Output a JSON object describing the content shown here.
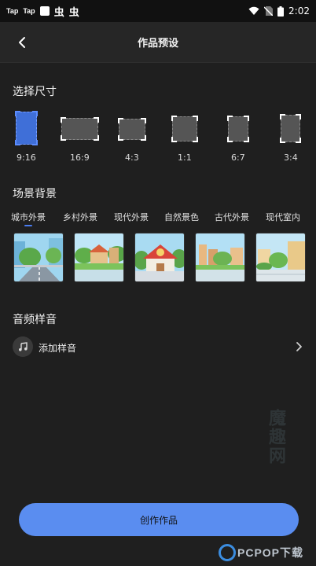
{
  "status_bar": {
    "apps": [
      "Tap",
      "Tap"
    ],
    "bug_glyphs": [
      "虫",
      "虫"
    ],
    "time": "2:02"
  },
  "header": {
    "title": "作品预设"
  },
  "size_section": {
    "title": "选择尺寸",
    "options": [
      {
        "label": "9:16",
        "selected": true
      },
      {
        "label": "16:9",
        "selected": false
      },
      {
        "label": "4:3",
        "selected": false
      },
      {
        "label": "1:1",
        "selected": false
      },
      {
        "label": "6:7",
        "selected": false
      },
      {
        "label": "3:4",
        "selected": false
      }
    ]
  },
  "scene_section": {
    "title": "场景背景",
    "tabs": [
      "城市外景",
      "乡村外景",
      "现代外景",
      "自然景色",
      "古代外景",
      "现代室内"
    ],
    "active_tab": "城市外景"
  },
  "audio_section": {
    "title": "音频样音",
    "add_label": "添加样音"
  },
  "footer": {
    "create_label": "创作作品"
  },
  "watermark": {
    "site_text": "魔趣网",
    "brand": "PCPOP下载"
  },
  "colors": {
    "background": "#1f1f1f",
    "accent": "#5a8df0",
    "selected": "#3f6fd8"
  }
}
